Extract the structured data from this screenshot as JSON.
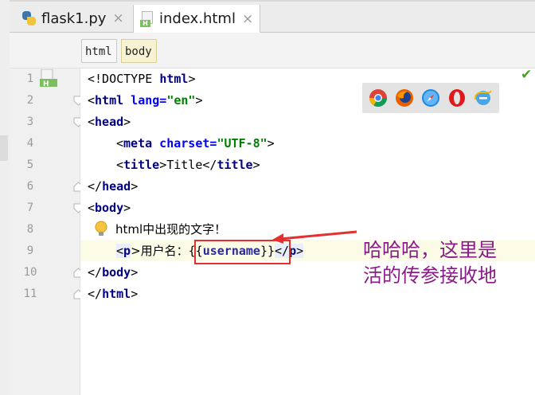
{
  "tabs": [
    {
      "label": "flask1.py",
      "icon": "python-file-icon",
      "active": false
    },
    {
      "label": "index.html",
      "icon": "html-file-icon",
      "active": true
    }
  ],
  "tab_close_glyph": "×",
  "breadcrumbs": [
    "html",
    "body"
  ],
  "line_numbers": [
    "1",
    "2",
    "3",
    "4",
    "5",
    "6",
    "7",
    "8",
    "9",
    "10",
    "11"
  ],
  "code": {
    "l1": {
      "pre": "<!DOCTYPE ",
      "tag": "html",
      "post": ">"
    },
    "l2": {
      "open": "<",
      "tag": "html",
      "attr": " lang=",
      "val": "\"en\"",
      "close": ">"
    },
    "l3": {
      "open": "<",
      "tag": "head",
      "close": ">"
    },
    "l4": {
      "open": "<",
      "tag": "meta",
      "attr": " charset=",
      "val": "\"UTF-8\"",
      "close": ">"
    },
    "l5": {
      "open": "<",
      "tag": "title",
      "mid": ">Title</",
      "tag2": "title",
      "close": ">"
    },
    "l6": {
      "open": "</",
      "tag": "head",
      "close": ">"
    },
    "l7": {
      "open": "<",
      "tag": "body",
      "close": ">"
    },
    "l8": {
      "text": "html中出现的文字！"
    },
    "l9": {
      "open": "<",
      "tag": "p",
      "mid": ">用户名：",
      "ph_open": "{{",
      "ph": "username",
      "ph_close": "}}",
      "end_open": "</",
      "tag2": "p",
      "close": ">"
    },
    "l10": {
      "open": "</",
      "tag": "body",
      "close": ">"
    },
    "l11": {
      "open": "</",
      "tag": "html",
      "close": ">"
    }
  },
  "annotation": {
    "line1": "哈哈哈，这里是",
    "line2": "活的传参接收地",
    "color": "#8a1a8a",
    "box_color": "#e53030"
  },
  "browser_icons": [
    "chrome-icon",
    "firefox-icon",
    "safari-icon",
    "opera-icon",
    "ie-icon"
  ],
  "status": {
    "inspection_ok": "✔"
  },
  "colors": {
    "tag": "#000080",
    "attr": "#0000ff",
    "value": "#008000",
    "current_line": "#fbfbe6"
  }
}
